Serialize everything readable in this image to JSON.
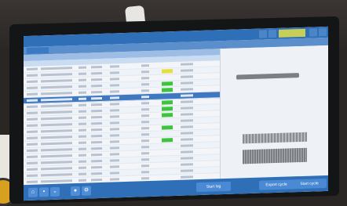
{
  "colors": {
    "accent": "#2f6fb7",
    "status_green": "#3cc43c",
    "status_yellow": "#e6df3a"
  },
  "toolbar": {
    "icons": [
      "home-icon",
      "lock-icon",
      "chevron-down-icon",
      "user-icon",
      "settings-icon"
    ],
    "start_log_label": "Start log",
    "export_label": "Export cycle",
    "start_cycle_label": "Start cycle"
  },
  "grid": {
    "rows": [
      {
        "status": "none"
      },
      {
        "status": "yellow"
      },
      {
        "status": "none"
      },
      {
        "status": "green"
      },
      {
        "status": "green"
      },
      {
        "status": "selected"
      },
      {
        "status": "green"
      },
      {
        "status": "green"
      },
      {
        "status": "green"
      },
      {
        "status": "none"
      },
      {
        "status": "green"
      },
      {
        "status": "none"
      },
      {
        "status": "green"
      },
      {
        "status": "none"
      },
      {
        "status": "none"
      },
      {
        "status": "none"
      },
      {
        "status": "none"
      },
      {
        "status": "none"
      },
      {
        "status": "none"
      },
      {
        "status": "none"
      }
    ]
  }
}
